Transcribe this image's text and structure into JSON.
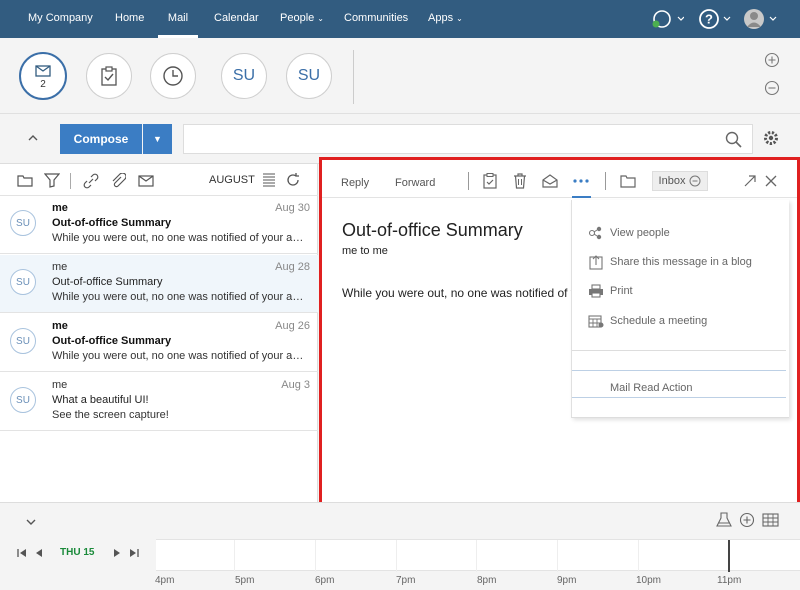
{
  "nav": {
    "items": [
      {
        "label": "My Company"
      },
      {
        "label": "Home"
      },
      {
        "label": "Mail",
        "active": true
      },
      {
        "label": "Calendar"
      },
      {
        "label": "People",
        "dropdown": true
      },
      {
        "label": "Communities"
      },
      {
        "label": "Apps",
        "dropdown": true
      }
    ],
    "icons": [
      "chat-status-icon",
      "help-icon",
      "user-avatar-icon"
    ]
  },
  "quickbar": {
    "mail_badge": "2",
    "people": [
      "SU",
      "SU"
    ]
  },
  "compose": {
    "label": "Compose"
  },
  "list": {
    "month": "AUGUST",
    "messages": [
      {
        "avatar": "SU",
        "from": "me",
        "date": "Aug 30",
        "subject": "Out-of-office Summary",
        "preview": "While you were out, no one was notified of your absence.",
        "unread": true
      },
      {
        "avatar": "SU",
        "from": "me",
        "date": "Aug 28",
        "subject": "Out-of-office Summary",
        "preview": "While you were out, no one was notified of your absence.",
        "unread": false,
        "selected": true
      },
      {
        "avatar": "SU",
        "from": "me",
        "date": "Aug 26",
        "subject": "Out-of-office Summary",
        "preview": "While you were out, no one was notified of your absence.",
        "unread": true
      },
      {
        "avatar": "SU",
        "from": "me",
        "date": "Aug 3",
        "subject": "What a beautiful UI!",
        "preview": "See the screen capture!",
        "unread": false
      }
    ]
  },
  "reading": {
    "reply": "Reply",
    "forward": "Forward",
    "folder_chip": "Inbox",
    "subject": "Out-of-office Summary",
    "recipients": "me to me",
    "body": "While you were out, no one was notified of y"
  },
  "actions_menu": {
    "items": [
      {
        "label": "View people",
        "icon": "view-people-icon"
      },
      {
        "label": "Share this message in a blog",
        "icon": "share-blog-icon"
      },
      {
        "label": "Print",
        "icon": "print-icon"
      },
      {
        "label": "Schedule a meeting",
        "icon": "schedule-meeting-icon"
      }
    ],
    "footer_item": "Mail Read Action"
  },
  "calendar_strip": {
    "day": "THU 15",
    "hours": [
      "4pm",
      "5pm",
      "6pm",
      "7pm",
      "8pm",
      "9pm",
      "10pm",
      "11pm"
    ]
  },
  "colors": {
    "nav_bg": "#325c80",
    "accent": "#3b7dc4",
    "highlight_border": "#e02020",
    "today": "#1a8a3a"
  }
}
